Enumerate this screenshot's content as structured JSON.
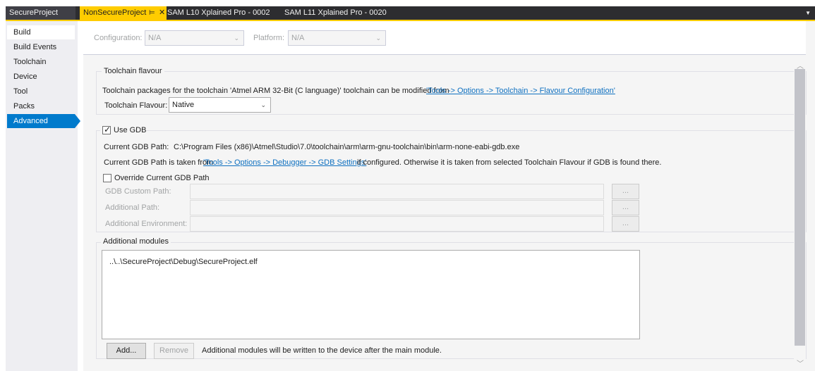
{
  "tabs": [
    {
      "label": "SecureProject"
    },
    {
      "label": "NonSecureProject",
      "pin": "⊨",
      "close": "✕"
    },
    {
      "label": "SAM L10 Xplained Pro - 0002"
    },
    {
      "label": "SAM L11 Xplained Pro - 0020"
    }
  ],
  "sidebar": {
    "items": [
      {
        "label": "Build"
      },
      {
        "label": "Build Events"
      },
      {
        "label": "Toolchain"
      },
      {
        "label": "Device"
      },
      {
        "label": "Tool"
      },
      {
        "label": "Packs"
      },
      {
        "label": "Advanced"
      }
    ],
    "selected": "Advanced"
  },
  "config": {
    "configuration_label": "Configuration:",
    "configuration_value": "N/A",
    "platform_label": "Platform:",
    "platform_value": "N/A"
  },
  "toolchain": {
    "title": "Toolchain flavour",
    "desc": "Toolchain packages for the toolchain 'Atmel ARM 32-Bit (C language)' toolchain can be modified from",
    "desc_link": "'Tools -> Options -> Toolchain -> Flavour Configuration'",
    "flavour_label": "Toolchain Flavour:",
    "flavour_value": "Native"
  },
  "gdb": {
    "use_label": "Use GDB",
    "use_checked": true,
    "path_label": "Current GDB Path:",
    "path_value": "C:\\Program Files (x86)\\Atmel\\Studio\\7.0\\toolchain\\arm\\arm-gnu-toolchain\\bin\\arm-none-eabi-gdb.exe",
    "note_prefix": "Current GDB Path is taken from",
    "note_link": "'Tools -> Options -> Debugger -> GDB Settings'",
    "note_suffix": "if configured. Otherwise it is taken from selected Toolchain Flavour if GDB is found there.",
    "override_label": "Override Current GDB Path",
    "override_checked": false,
    "custom_path_label": "GDB Custom Path:",
    "additional_path_label": "Additional Path:",
    "additional_env_label": "Additional Environment:",
    "browse_label": "..."
  },
  "modules": {
    "title": "Additional modules",
    "items": [
      "..\\..\\SecureProject\\Debug\\SecureProject.elf"
    ],
    "add_label": "Add...",
    "remove_label": "Remove",
    "note": "Additional modules will be written to the device after the main module."
  },
  "colors": {
    "accent": "#007acc",
    "active_tab": "#ffcc00",
    "link": "#0e70c0"
  }
}
